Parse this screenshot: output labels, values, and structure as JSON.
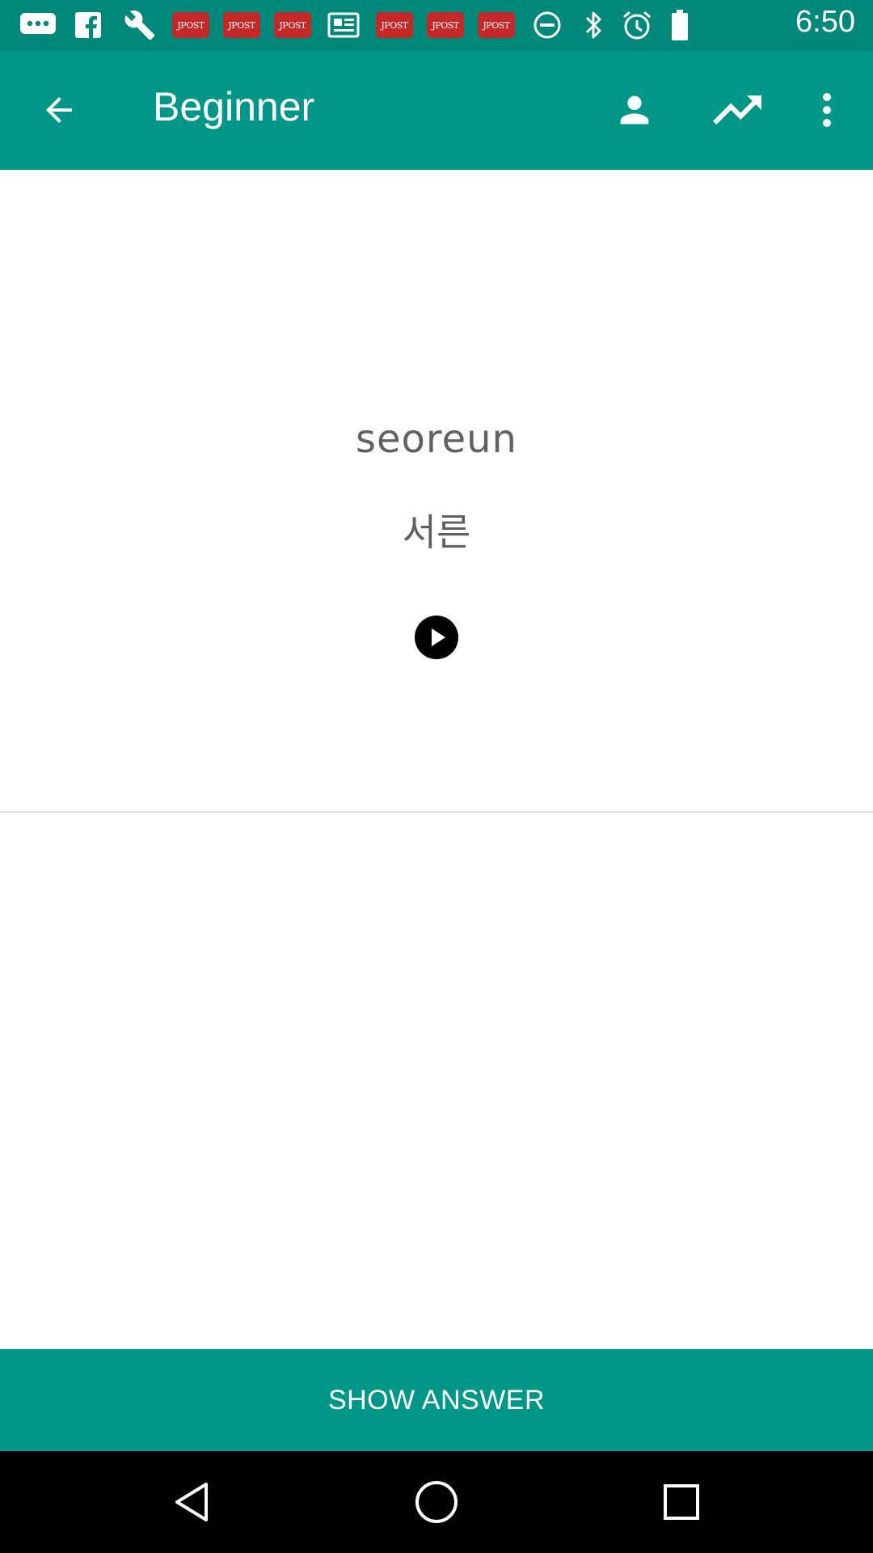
{
  "status_bar": {
    "time": "6:50",
    "notification_icons": [
      "chat-bubble-icon",
      "wrench-icon",
      "jpost-icon",
      "jpost-icon",
      "jpost-icon",
      "newspaper-icon",
      "jpost-icon",
      "jpost-icon",
      "jpost-icon"
    ],
    "jpost_label": "JPOST",
    "system_icons": [
      "do-not-disturb-icon",
      "bluetooth-icon",
      "alarm-icon",
      "battery-icon"
    ]
  },
  "toolbar": {
    "title": "Beginner",
    "actions": [
      "profile-icon",
      "trending-up-icon",
      "more-vert-icon"
    ]
  },
  "card": {
    "romanized": "seoreun",
    "hangul": "서른"
  },
  "footer": {
    "show_answer_label": "SHOW ANSWER"
  },
  "colors": {
    "primary": "#009688",
    "primary_dark": "#00897b",
    "jpost_red": "#c62828",
    "text_gray": "#616161"
  }
}
